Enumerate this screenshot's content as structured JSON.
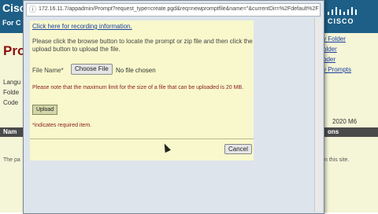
{
  "background_page": {
    "brand": "Cisco",
    "brand_sub": "For C",
    "logo_text": "CISCO",
    "page_title": "Prom",
    "side_labels": [
      "Langu",
      "Folde",
      "Code"
    ],
    "links": [
      "v Folder",
      "older",
      "oder",
      "v Prompts"
    ],
    "band_labels": [
      "Nam",
      "ons"
    ],
    "date_text": "2020 M6",
    "footer_left": "The pa",
    "footer_right": "n this site."
  },
  "popup": {
    "address_url": "172.16.11.7/appadmin/Prompt?request_type=create.pgd&req=newpromptfile&name=\"&currentDir=%2Fdefault%2F",
    "recording_link": "Click here for recording information.",
    "instructions": "Please click the browse button to locate the prompt or zip file and then click the upload button to upload the file.",
    "file_name_label": "File Name*",
    "choose_file_label": "Choose File",
    "no_file_text": "No file chosen",
    "size_note": "Please note that the maximum limit for the size of a file that can be uploaded is 20 MB.",
    "upload_label": "Upload",
    "required_note": "*indicates required item.",
    "cancel_label": "Cancel"
  },
  "colors": {
    "header_blue": "#1d5f86",
    "content_yellow": "#f8f8cc",
    "title_red": "#8b1010",
    "link_blue": "#1a3fa0"
  }
}
